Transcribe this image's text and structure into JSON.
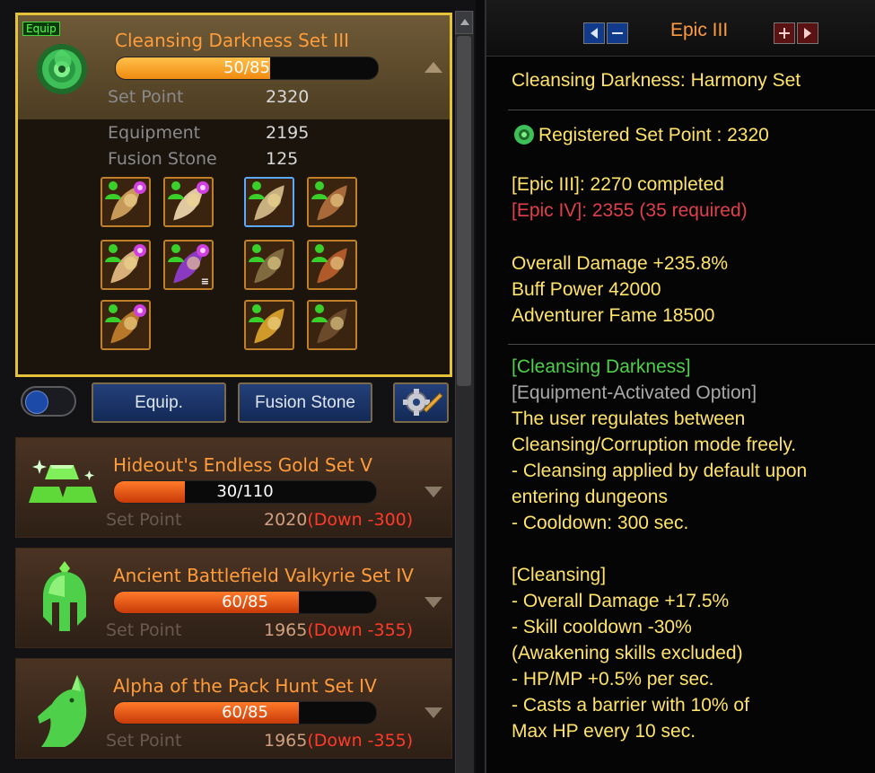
{
  "active_set": {
    "badge": "Equip",
    "title": "Cleansing Darkness Set III",
    "progress_text": "50/85",
    "progress_fraction": 0.588,
    "set_point_label": "Set Point",
    "set_point_value": "2320",
    "equipment_label": "Equipment",
    "equipment_value": "2195",
    "fusion_label": "Fusion Stone",
    "fusion_value": "125"
  },
  "controls": {
    "equip_label": "Equip.",
    "fusion_label": "Fusion Stone"
  },
  "other_sets": [
    {
      "title": "Hideout's Endless Gold Set V",
      "progress_text": "30/110",
      "progress_fraction": 0.27,
      "set_point_label": "Set Point",
      "set_point_value": "2020",
      "down_text": "(Down -300)"
    },
    {
      "title": "Ancient Battlefield Valkyrie Set IV",
      "progress_text": "60/85",
      "progress_fraction": 0.706,
      "set_point_label": "Set Point",
      "set_point_value": "1965",
      "down_text": "(Down -355)"
    },
    {
      "title": "Alpha of the Pack Hunt Set IV",
      "progress_text": "60/85",
      "progress_fraction": 0.706,
      "set_point_label": "Set Point",
      "set_point_value": "1965",
      "down_text": "(Down -355)"
    }
  ],
  "detail": {
    "grade": "Epic III",
    "set_name": "Cleansing Darkness: Harmony Set",
    "registered_prefix": "Registered ",
    "registered_label": "Set Point : 2320",
    "epic3_line": "[Epic III]: 2270 completed",
    "epic4_line": "[Epic IV]: 2355 (35 required)",
    "stat_lines": [
      "Overall Damage +235.8%",
      "Buff Power 42000",
      "Adventurer Fame 18500"
    ],
    "option_title": "[Cleansing Darkness]",
    "option_sub": "[Equipment-Activated Option]",
    "option_lines": [
      "The user regulates between",
      "Cleansing/Corruption mode freely.",
      "- Cleansing applied by default upon",
      "entering dungeons",
      "- Cooldown: 300 sec."
    ],
    "cleansing_title": "[Cleansing]",
    "cleansing_lines": [
      "- Overall Damage +17.5%",
      "- Skill cooldown -30%",
      "(Awakening skills excluded)",
      "- HP/MP +0.5% per sec.",
      "- Casts a barrier with 10% of",
      "Max HP every 10 sec."
    ]
  },
  "colors": {
    "title_orange": "#ff9c3b",
    "gold_border": "#e6c13a",
    "detail_yellow": "#ffe36a",
    "required_red": "#e0404a",
    "green": "#4ed04a"
  },
  "icons": [
    "rose-set-icon",
    "gold-bars-icon",
    "valkyrie-helmet-icon",
    "wolf-icon",
    "gear-wrench-icon"
  ]
}
